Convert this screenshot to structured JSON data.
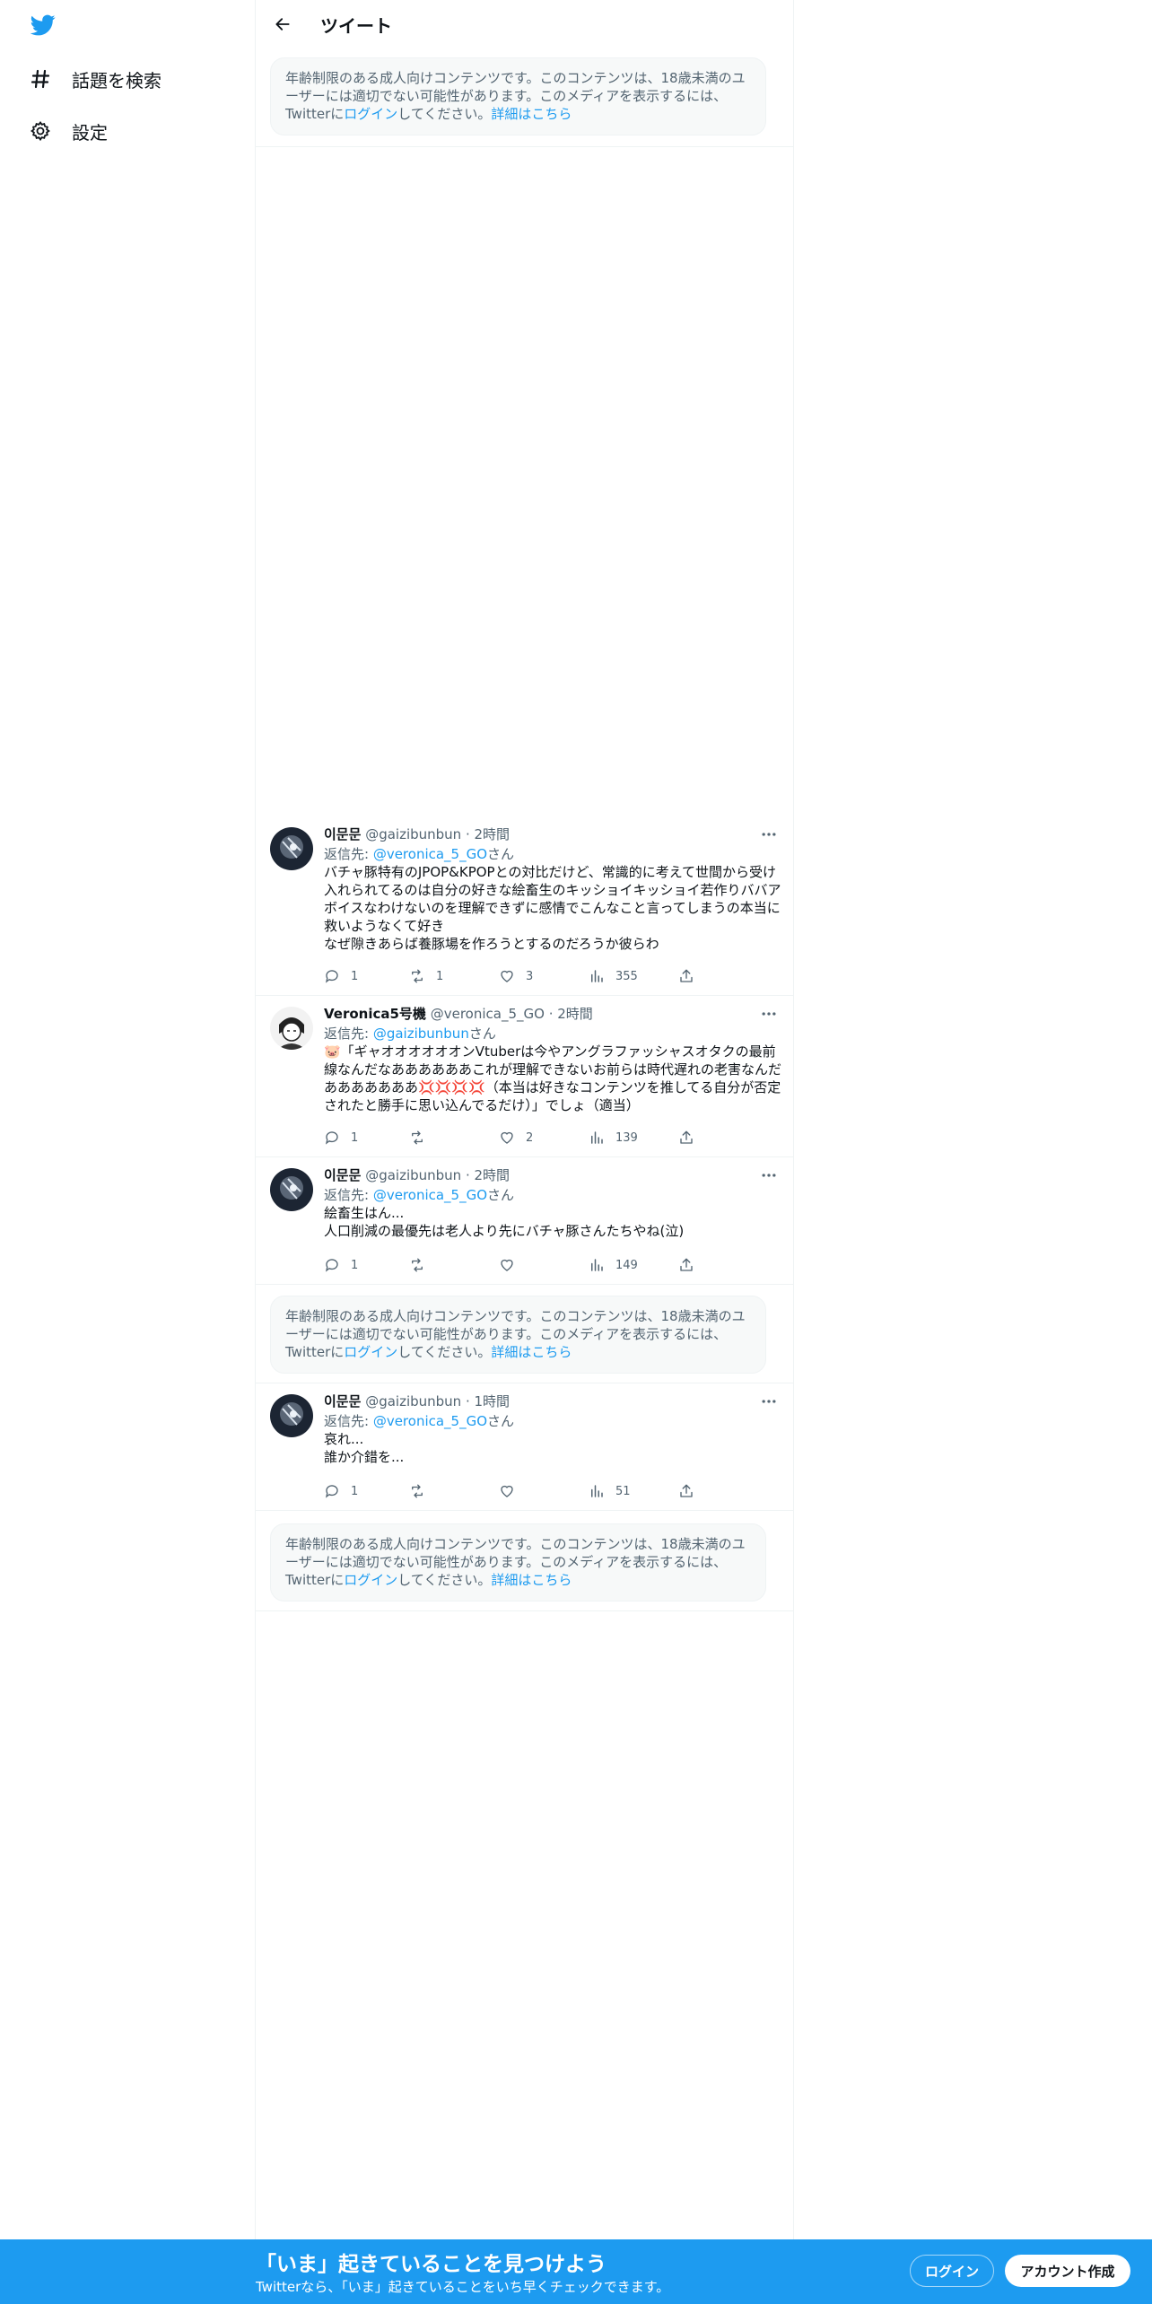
{
  "sidebar": {
    "logo_icon": "twitter-bird-icon",
    "items": [
      {
        "label": "話題を検索",
        "icon": "hashtag-icon"
      },
      {
        "label": "設定",
        "icon": "gear-icon"
      }
    ]
  },
  "header": {
    "title": "ツイート",
    "back_icon": "arrow-left-icon"
  },
  "notice": {
    "text_before": "年齢制限のある成人向けコンテンツです。このコンテンツは、18歳未満のユーザーには適切でない可能性があります。このメディアを表示するには、Twitterに",
    "login_link": "ログイン",
    "text_after": "してください。",
    "details_link": "詳細はこちら"
  },
  "tweets": [
    {
      "name": "이문문",
      "handle": "@gaizibunbun",
      "time": "· 2時間",
      "reply_prefix": "返信先: ",
      "reply_to": "@veronica_5_GO",
      "reply_suffix": "さん",
      "lines": [
        "バチャ豚特有のJPOP&KPOPとの対比だけど、常識的に考えて世間から受け入れられてるのは自分の好きな絵畜生のキッショイキッショイ若作りババアボイスなわけないのを理解できずに感情でこんなこと言ってしまうの本当に救いようなくて好き",
        "なぜ隙きあらば養豚場を作ろうとするのだろうか彼らわ"
      ],
      "replies": "1",
      "retweets": "1",
      "likes": "3",
      "views": "355"
    },
    {
      "name": "Veronica5号機",
      "handle": "@veronica_5_GO",
      "time": "· 2時間",
      "reply_prefix": "返信先: ",
      "reply_to": "@gaizibunbun",
      "reply_suffix": "さん",
      "lines": [
        "🐷「ギャオオオオオオンVtuberは今やアングラファッシャスオタクの最前線なんだなああああああこれが理解できないお前らは時代遅れの老害なんだあああああああ💢💢💢💢（本当は好きなコンテンツを推してる自分が否定されたと勝手に思い込んでるだけ）」でしょ（適当）"
      ],
      "replies": "1",
      "retweets": "",
      "likes": "2",
      "views": "139"
    },
    {
      "name": "이문문",
      "handle": "@gaizibunbun",
      "time": "· 2時間",
      "reply_prefix": "返信先: ",
      "reply_to": "@veronica_5_GO",
      "reply_suffix": "さん",
      "lines": [
        "絵畜生はん...",
        "人口削減の最優先は老人より先にバチャ豚さんたちやね(泣)"
      ],
      "replies": "1",
      "retweets": "",
      "likes": "",
      "views": "149"
    },
    {
      "name": "이문문",
      "handle": "@gaizibunbun",
      "time": "· 1時間",
      "reply_prefix": "返信先: ",
      "reply_to": "@veronica_5_GO",
      "reply_suffix": "さん",
      "lines": [
        "哀れ...",
        "誰か介錯を..."
      ],
      "replies": "1",
      "retweets": "",
      "likes": "",
      "views": "51"
    }
  ],
  "bottom_bar": {
    "title": "「いま」起きていることを見つけよう",
    "subtitle": "Twitterなら、「いま」起きていることをいち早くチェックできます。",
    "login": "ログイン",
    "signup": "アカウント作成"
  },
  "colors": {
    "accent": "#1d9bf0",
    "text": "#0f1419",
    "muted": "#536471"
  }
}
